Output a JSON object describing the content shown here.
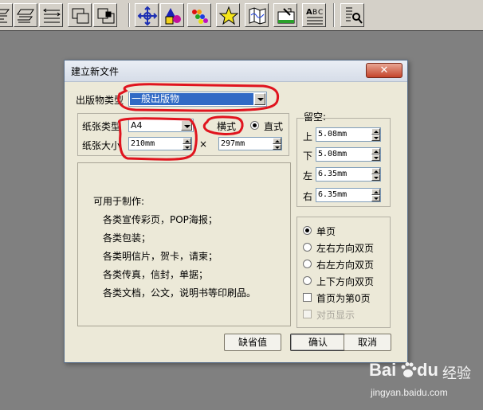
{
  "toolbar": {
    "buttons": [
      {
        "icon": "align-left-text-icon"
      },
      {
        "icon": "align-justify-text-icon"
      },
      {
        "icon": "text-flow-icon"
      },
      {
        "icon": "layers-back-icon"
      },
      {
        "icon": "layers-front-icon"
      },
      {
        "icon": "move-crosshair-icon"
      },
      {
        "icon": "shapes-icon"
      },
      {
        "icon": "color-palette-icon"
      },
      {
        "icon": "star-icon"
      },
      {
        "icon": "map-icon"
      },
      {
        "icon": "image-edit-icon"
      },
      {
        "icon": "text-table-icon"
      },
      {
        "icon": "zoom-page-icon"
      }
    ]
  },
  "dialog": {
    "title": "建立新文件",
    "close_symbol": "✕",
    "publication_type": {
      "label": "出版物类型",
      "value": "一般出版物"
    },
    "paper_type": {
      "label": "纸张类型",
      "value": "A4"
    },
    "paper_size": {
      "label": "纸张大小",
      "width": "210mm",
      "times": "×",
      "height": "297mm"
    },
    "orientation": {
      "landscape": "横式",
      "portrait": "直式",
      "selected": "portrait"
    },
    "margins": {
      "label": "留空:",
      "top": {
        "label": "上",
        "value": "5.08mm"
      },
      "bottom": {
        "label": "下",
        "value": "5.08mm"
      },
      "left": {
        "label": "左",
        "value": "6.35mm"
      },
      "right": {
        "label": "右",
        "value": "6.35mm"
      }
    },
    "page_options": {
      "single": "单页",
      "lr_double": "左右方向双页",
      "rl_double": "右左方向双页",
      "ud_double": "上下方向双页",
      "first_page_zero": "首页为第0页",
      "facing_display": "对页显示",
      "selected": "single"
    },
    "description": {
      "heading": "可用于制作:",
      "lines": [
        "各类宣传彩页，POP海报；",
        "各类包装；",
        "各类明信片，贺卡，请柬；",
        "各类传真，信封，单据；",
        "各类文档，公文，说明书等印刷品。"
      ]
    },
    "buttons": {
      "defaults": "缺省值",
      "ok": "确认",
      "cancel": "取消"
    }
  },
  "watermark": {
    "brand": "Bai",
    "brand2": "du",
    "suffix": "经验",
    "url": "jingyan.baidu.com"
  },
  "colors": {
    "annotation": "#e0141e",
    "selection": "#316ac5",
    "desktop": "#808080"
  }
}
